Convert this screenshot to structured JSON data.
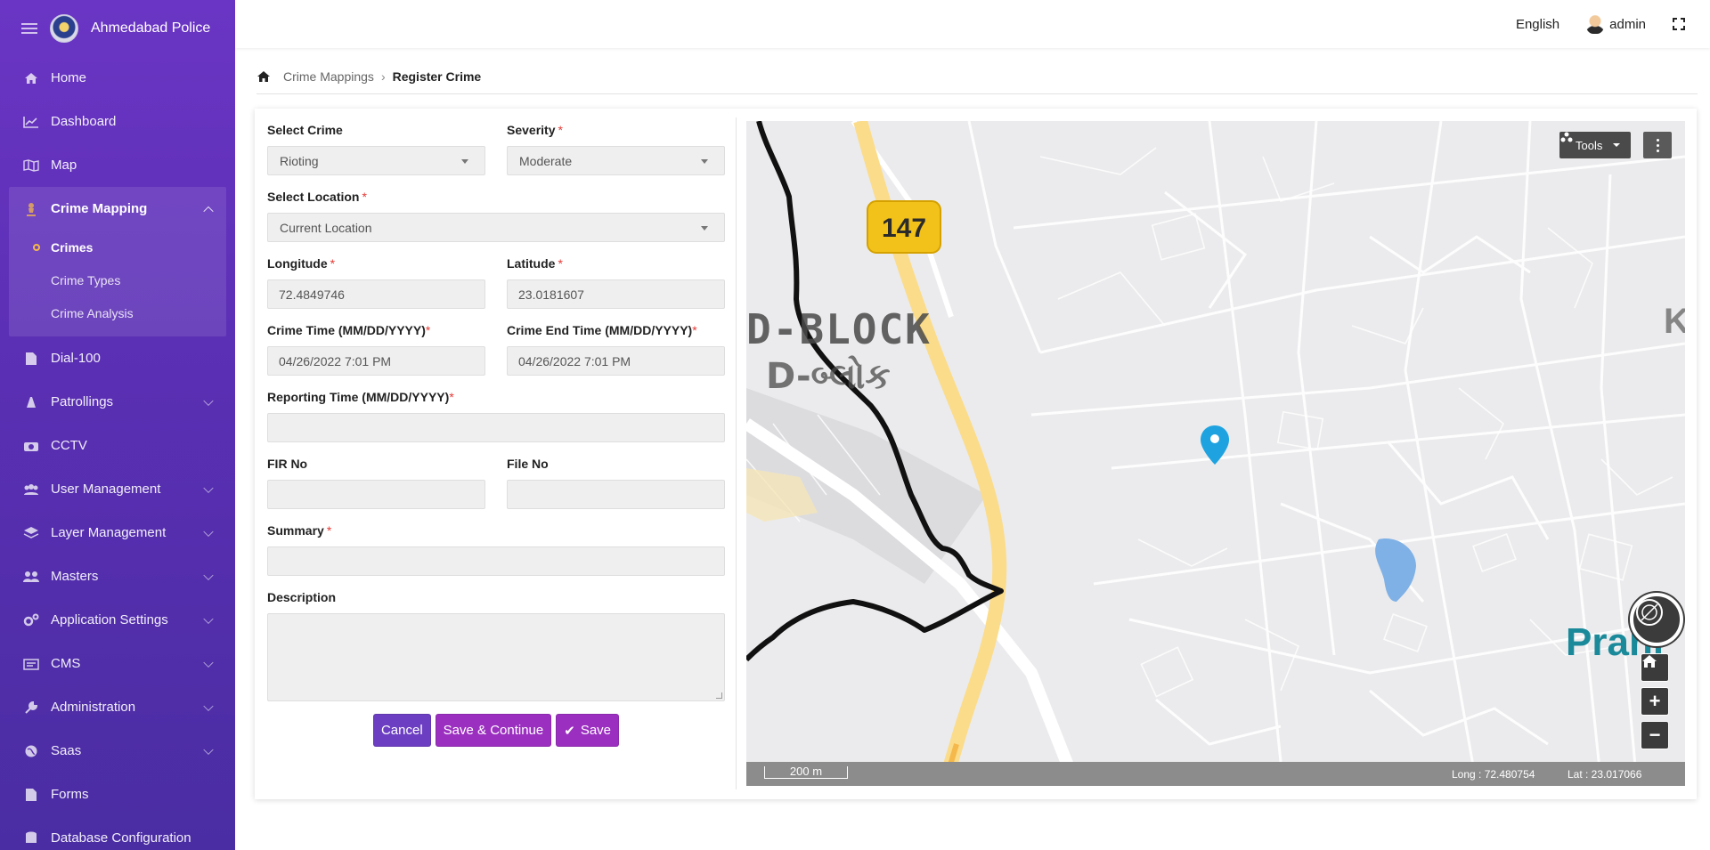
{
  "app": {
    "title": "Ahmedabad Police"
  },
  "sidebar": {
    "items": [
      {
        "label": "Home"
      },
      {
        "label": "Dashboard"
      },
      {
        "label": "Map"
      }
    ],
    "crime_group": {
      "label": "Crime Mapping",
      "sub_items": [
        {
          "label": "Crimes",
          "active": true
        },
        {
          "label": "Crime Types"
        },
        {
          "label": "Crime Analysis"
        }
      ]
    },
    "items_after": [
      {
        "label": "Dial-100"
      },
      {
        "label": "Patrollings"
      },
      {
        "label": "CCTV"
      },
      {
        "label": "User Management"
      },
      {
        "label": "Layer Management"
      },
      {
        "label": "Masters"
      },
      {
        "label": "Application Settings"
      },
      {
        "label": "CMS"
      },
      {
        "label": "Administration"
      },
      {
        "label": "Saas"
      },
      {
        "label": "Forms"
      },
      {
        "label": "Database Configuration"
      }
    ]
  },
  "topbar": {
    "language": "English",
    "username": "admin"
  },
  "breadcrumb": {
    "parent": "Crime Mappings",
    "current": "Register Crime"
  },
  "form": {
    "select_crime": {
      "label": "Select Crime",
      "value": "Rioting"
    },
    "severity": {
      "label": "Severity",
      "required": "*",
      "value": "Moderate"
    },
    "select_location": {
      "label": "Select Location",
      "required": "*",
      "value": "Current Location"
    },
    "longitude": {
      "label": "Longitude",
      "required": "*",
      "value": "72.4849746"
    },
    "latitude": {
      "label": "Latitude",
      "required": "*",
      "value": "23.0181607"
    },
    "crime_time": {
      "label": "Crime Time (MM/DD/YYYY)",
      "required": "*",
      "value": "04/26/2022 7:01 PM"
    },
    "crime_end_time": {
      "label": "Crime End Time (MM/DD/YYYY)",
      "required": "*",
      "value": "04/26/2022 7:01 PM"
    },
    "reporting_time": {
      "label": "Reporting Time (MM/DD/YYYY)",
      "required": "*",
      "value": ""
    },
    "fir_no": {
      "label": "FIR No",
      "value": ""
    },
    "file_no": {
      "label": "File No",
      "value": ""
    },
    "summary": {
      "label": "Summary",
      "required": "*",
      "value": ""
    },
    "description": {
      "label": "Description",
      "value": ""
    },
    "buttons": {
      "cancel": "Cancel",
      "save_continue": "Save & Continue",
      "save": "Save"
    }
  },
  "map": {
    "tools_label": "Tools",
    "road_badge": "147",
    "block_label": "D-BLOCK",
    "block_label_guj": "D-બ્લોક",
    "edge_label_k": "K",
    "edge_label_prahlad": "Prahl",
    "scale": "200 m",
    "long_readout": "Long : 72.480754",
    "lat_readout": "Lat : 23.017066",
    "marker_color": "#1fa3e0"
  },
  "colors": {
    "sidebar_top": "#6a35c4",
    "sidebar_bottom": "#4a2da3",
    "btn_cancel": "#6c3fc2",
    "btn_save": "#9b2fc0",
    "required": "#e53935"
  }
}
